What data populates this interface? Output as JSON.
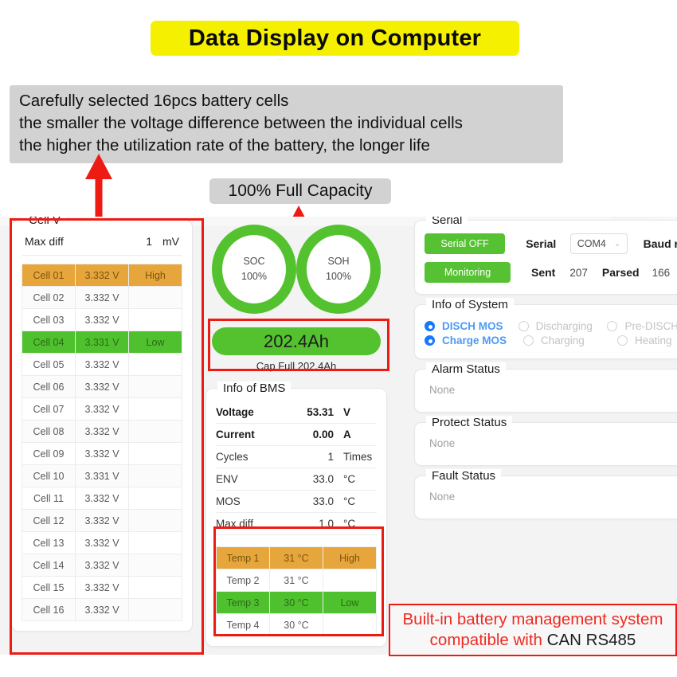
{
  "banner": {
    "title": "Data Display on Computer"
  },
  "notes": {
    "cells_note": [
      "Carefully selected 16pcs battery cells",
      "the smaller the voltage difference between the individual cells",
      "the higher the utilization rate of the battery, the longer life"
    ],
    "capacity_callout": "100% Full Capacity",
    "claim_line1": "Built-in battery management system",
    "claim_line2_red": "compatible with ",
    "claim_line2_black": "CAN RS485"
  },
  "cell_v": {
    "legend": "Cell V",
    "max_diff_label": "Max diff",
    "max_diff_value": "1",
    "max_diff_unit": "mV",
    "rows": [
      {
        "name": "Cell 01",
        "voltage": "3.332 V",
        "flag": "High",
        "state": "high"
      },
      {
        "name": "Cell 02",
        "voltage": "3.332 V",
        "flag": "",
        "state": "alt"
      },
      {
        "name": "Cell 03",
        "voltage": "3.332 V",
        "flag": "",
        "state": "normal"
      },
      {
        "name": "Cell 04",
        "voltage": "3.331 V",
        "flag": "Low",
        "state": "low"
      },
      {
        "name": "Cell 05",
        "voltage": "3.332 V",
        "flag": "",
        "state": "normal"
      },
      {
        "name": "Cell 06",
        "voltage": "3.332 V",
        "flag": "",
        "state": "alt"
      },
      {
        "name": "Cell 07",
        "voltage": "3.332 V",
        "flag": "",
        "state": "normal"
      },
      {
        "name": "Cell 08",
        "voltage": "3.332 V",
        "flag": "",
        "state": "alt"
      },
      {
        "name": "Cell 09",
        "voltage": "3.332 V",
        "flag": "",
        "state": "normal"
      },
      {
        "name": "Cell 10",
        "voltage": "3.331 V",
        "flag": "",
        "state": "alt"
      },
      {
        "name": "Cell 11",
        "voltage": "3.332 V",
        "flag": "",
        "state": "normal"
      },
      {
        "name": "Cell 12",
        "voltage": "3.332 V",
        "flag": "",
        "state": "alt"
      },
      {
        "name": "Cell 13",
        "voltage": "3.332 V",
        "flag": "",
        "state": "normal"
      },
      {
        "name": "Cell 14",
        "voltage": "3.332 V",
        "flag": "",
        "state": "alt"
      },
      {
        "name": "Cell 15",
        "voltage": "3.332 V",
        "flag": "",
        "state": "normal"
      },
      {
        "name": "Cell 16",
        "voltage": "3.332 V",
        "flag": "",
        "state": "alt"
      }
    ]
  },
  "gauges": {
    "soc": {
      "label": "SOC",
      "value": "100%"
    },
    "soh": {
      "label": "SOH",
      "value": "100%"
    }
  },
  "capacity": {
    "pill": "202.4Ah",
    "sub": "Cap Full  202.4Ah"
  },
  "bms": {
    "legend": "Info of BMS",
    "rows": [
      {
        "key": "Voltage",
        "value": "53.31",
        "unit": "V",
        "bold": true
      },
      {
        "key": "Current",
        "value": "0.00",
        "unit": "A",
        "bold": true
      },
      {
        "key": "Cycles",
        "value": "1",
        "unit": "Times",
        "bold": false
      },
      {
        "key": "ENV",
        "value": "33.0",
        "unit": "°C",
        "bold": false
      },
      {
        "key": "MOS",
        "value": "33.0",
        "unit": "°C",
        "bold": false
      },
      {
        "key": "Max diff",
        "value": "1.0",
        "unit": "°C",
        "bold": false
      }
    ]
  },
  "temps": {
    "rows": [
      {
        "name": "Temp 1",
        "value": "31 °C",
        "flag": "High",
        "state": "high"
      },
      {
        "name": "Temp 2",
        "value": "31 °C",
        "flag": "",
        "state": "normal"
      },
      {
        "name": "Temp 3",
        "value": "30 °C",
        "flag": "Low",
        "state": "low"
      },
      {
        "name": "Temp 4",
        "value": "30 °C",
        "flag": "",
        "state": "normal"
      }
    ]
  },
  "serial": {
    "legend": "Serial",
    "btn_serial": "Serial OFF",
    "btn_monitoring": "Monitoring",
    "serial_label": "Serial",
    "port_value": "COM4",
    "chevron": "⌄",
    "baud_label": "Baud r",
    "sent_label": "Sent",
    "sent_value": "207",
    "parsed_label": "Parsed",
    "parsed_value": "166"
  },
  "system": {
    "legend": "Info of System",
    "row1": [
      {
        "label": "DISCH MOS",
        "on": true
      },
      {
        "label": "Discharging",
        "on": false
      },
      {
        "label": "Pre-DISCH",
        "on": false
      }
    ],
    "row2": [
      {
        "label": "Charge MOS",
        "on": true
      },
      {
        "label": "Charging",
        "on": false
      },
      {
        "label": "Heating",
        "on": false
      }
    ]
  },
  "statuses": [
    {
      "legend": "Alarm Status",
      "value": "None"
    },
    {
      "legend": "Protect Status",
      "value": "None"
    },
    {
      "legend": "Fault Status",
      "value": "None"
    }
  ],
  "colors": {
    "banner_yellow": "#f5f000",
    "note_gray": "#d2d2d2",
    "accent_red": "#ee1b12",
    "green": "#54c22f",
    "orange": "#e6a63c",
    "blue": "#1677ff"
  }
}
